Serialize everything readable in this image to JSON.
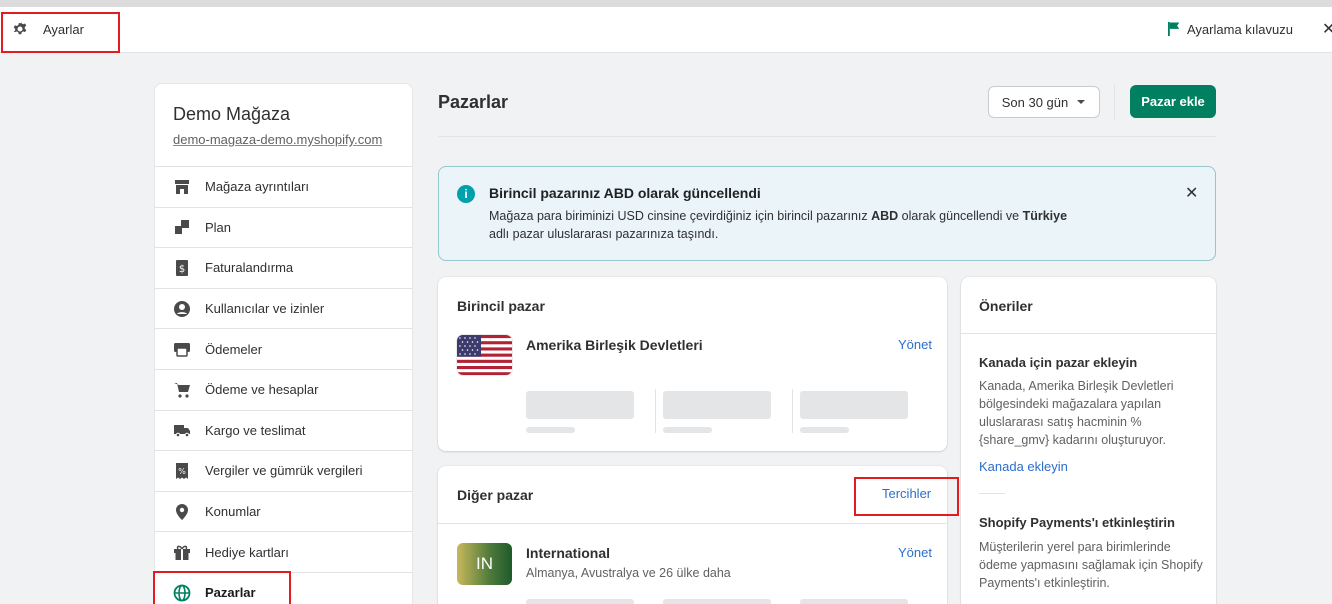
{
  "topbar": {
    "title": "Ayarlar",
    "guide_label": "Ayarlama kılavuzu",
    "icons": {
      "settings": "gear-icon",
      "guide": "flag-icon",
      "close": "close-icon"
    },
    "colors": {
      "guide_flag": "#008060"
    }
  },
  "sidebar": {
    "store_name": "Demo Mağaza",
    "store_url": "demo-magaza-demo.myshopify.com",
    "items": [
      {
        "label": "Mağaza ayrıntıları",
        "icon": "store-icon"
      },
      {
        "label": "Plan",
        "icon": "plan-icon"
      },
      {
        "label": "Faturalandırma",
        "icon": "billing-icon"
      },
      {
        "label": "Kullanıcılar ve izinler",
        "icon": "user-icon"
      },
      {
        "label": "Ödemeler",
        "icon": "payments-icon"
      },
      {
        "label": "Ödeme ve hesaplar",
        "icon": "cart-icon"
      },
      {
        "label": "Kargo ve teslimat",
        "icon": "truck-icon"
      },
      {
        "label": "Vergiler ve gümrük vergileri",
        "icon": "tax-icon"
      },
      {
        "label": "Konumlar",
        "icon": "location-icon"
      },
      {
        "label": "Hediye kartları",
        "icon": "gift-icon"
      },
      {
        "label": "Pazarlar",
        "icon": "globe-icon",
        "active": true
      }
    ]
  },
  "main": {
    "title": "Pazarlar",
    "period_label": "Son 30 gün",
    "add_market_label": "Pazar ekle",
    "colors": {
      "primary": "#008060",
      "link": "#2c6ecb",
      "info": "#00a0ac"
    }
  },
  "banner": {
    "title": "Birincil pazarınız ABD olarak güncellendi",
    "text_before": "Mağaza para biriminizi USD cinsine çevirdiğiniz için birincil pazarınız ",
    "text_bold1": "ABD",
    "text_mid": " olarak güncellendi ve ",
    "text_bold2": "Türkiye",
    "text_after": " adlı pazar uluslararası pazarınıza taşındı."
  },
  "primary_market": {
    "title": "Birincil pazar",
    "country": "Amerika Birleşik Devletleri",
    "manage_label": "Yönet"
  },
  "other_markets": {
    "title": "Diğer pazar",
    "preferences_label": "Tercihler",
    "market": {
      "badge": "IN",
      "name": "International",
      "subtitle": "Almanya, Avustralya ve 26 ülke daha",
      "manage_label": "Yönet"
    }
  },
  "recommendations": {
    "title": "Öneriler",
    "items": [
      {
        "title": "Kanada için pazar ekleyin",
        "text": "Kanada, Amerika Birleşik Devletleri bölgesindeki mağazalara yapılan uluslararası satış hacminin %{share_gmv} kadarını oluşturuyor.",
        "link": "Kanada ekleyin"
      },
      {
        "title": "Shopify Payments'ı etkinleştirin",
        "text": "Müşterilerin yerel para birimlerinde ödeme yapmasını sağlamak için Shopify Payments'ı etkinleştirin."
      }
    ]
  }
}
